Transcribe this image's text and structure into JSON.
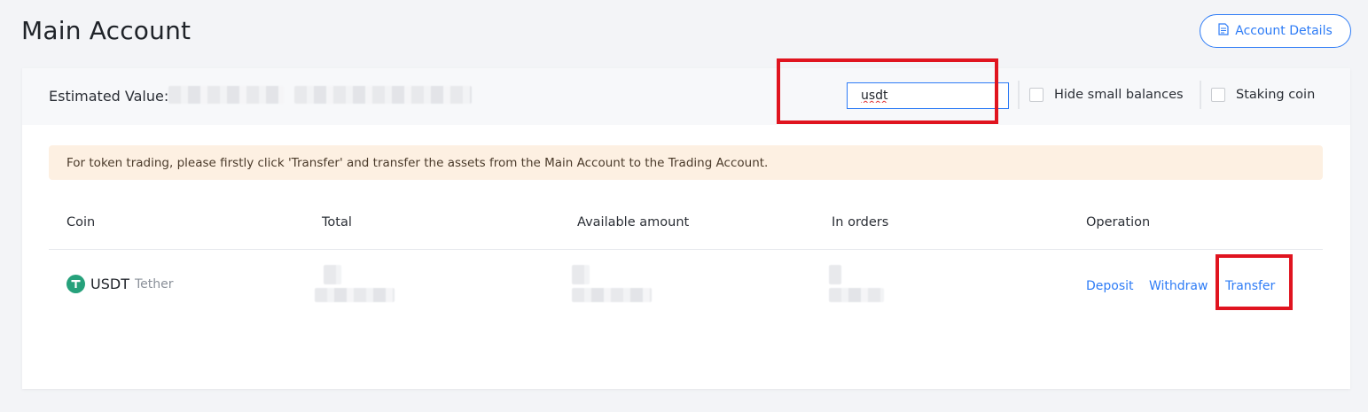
{
  "page": {
    "title": "Main Account",
    "details_button_label": "Account Details"
  },
  "header": {
    "estimated_value_label": "Estimated Value:",
    "search_value": "usdt",
    "hide_small_balances_label": "Hide small balances",
    "staking_coin_label": "Staking coin"
  },
  "notice": {
    "text": "For token trading, please firstly click 'Transfer' and transfer the assets from the Main Account to the Trading Account."
  },
  "table": {
    "columns": [
      "Coin",
      "Total",
      "Available amount",
      "In orders",
      "Operation"
    ],
    "rows": [
      {
        "symbol": "USDT",
        "name": "Tether",
        "operations": [
          "Deposit",
          "Withdraw",
          "Transfer"
        ]
      }
    ]
  },
  "colors": {
    "accent": "#2e7cf6",
    "highlight": "#e0141f",
    "tether": "#26a17b",
    "notice_bg": "#fdf0e2"
  },
  "icons": {
    "details": "document-icon",
    "coin": "tether-icon"
  }
}
